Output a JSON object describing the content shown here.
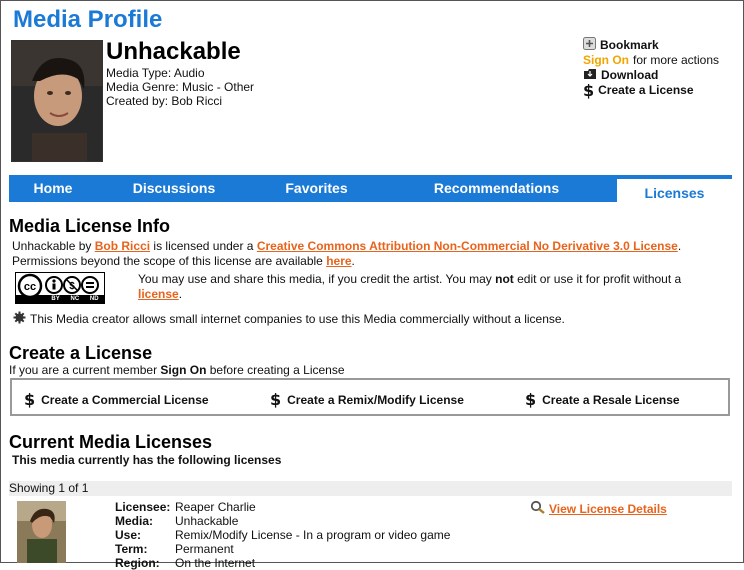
{
  "page": {
    "title": "Media Profile"
  },
  "media": {
    "name": "Unhackable",
    "type_line": "Media Type: Audio",
    "genre_line": "Media Genre: Music - Other",
    "creator_line": "Created by: Bob Ricci"
  },
  "actions": {
    "bookmark": "Bookmark",
    "signon": "Sign On",
    "signon_suffix": "for more actions",
    "download": "Download",
    "create_license": "Create a License"
  },
  "tabs": [
    {
      "label": "Home"
    },
    {
      "label": "Discussions"
    },
    {
      "label": "Favorites"
    },
    {
      "label": "Recommendations"
    },
    {
      "label": "Licenses"
    }
  ],
  "license_info": {
    "heading": "Media License Info",
    "line1_a": "Unhackable by",
    "line1_author": "Bob Ricci",
    "line1_b": "is licensed under a",
    "line1_license": "Creative Commons Attribution Non-Commercial No Derivative 3.0 License",
    "line2_a": "Permissions beyond the scope of this license are available",
    "line2_link": "here",
    "share_a": "You may use and share this media, if you credit the artist. You may",
    "share_not": "not",
    "share_b": "edit or use it for profit without a",
    "share_link": "license",
    "cc_labels": [
      "BY",
      "NC",
      "ND"
    ],
    "commercial_note": "This Media creator allows small internet companies to use this Media commercially without a license."
  },
  "create": {
    "heading": "Create a License",
    "note_a": "If you are a current member",
    "note_signon": "Sign On",
    "note_b": "before creating a License",
    "buttons": [
      {
        "label": "Create a Commercial License"
      },
      {
        "label": "Create a Remix/Modify License"
      },
      {
        "label": "Create a Resale License"
      }
    ]
  },
  "current": {
    "heading": "Current Media Licenses",
    "sub": "This media currently has the following licenses",
    "showing": "Showing 1 of 1",
    "view_details": "View License Details",
    "rows": [
      {
        "k": "Licensee:",
        "v": "Reaper Charlie"
      },
      {
        "k": "Media:",
        "v": "Unhackable"
      },
      {
        "k": "Use:",
        "v": "Remix/Modify License - In a program or video game"
      },
      {
        "k": "Term:",
        "v": "Permanent"
      },
      {
        "k": "Region:",
        "v": "On the Internet"
      }
    ]
  },
  "colors": {
    "accent": "#1a7ad6",
    "link": "#e8631c",
    "signon": "#f0a500"
  }
}
